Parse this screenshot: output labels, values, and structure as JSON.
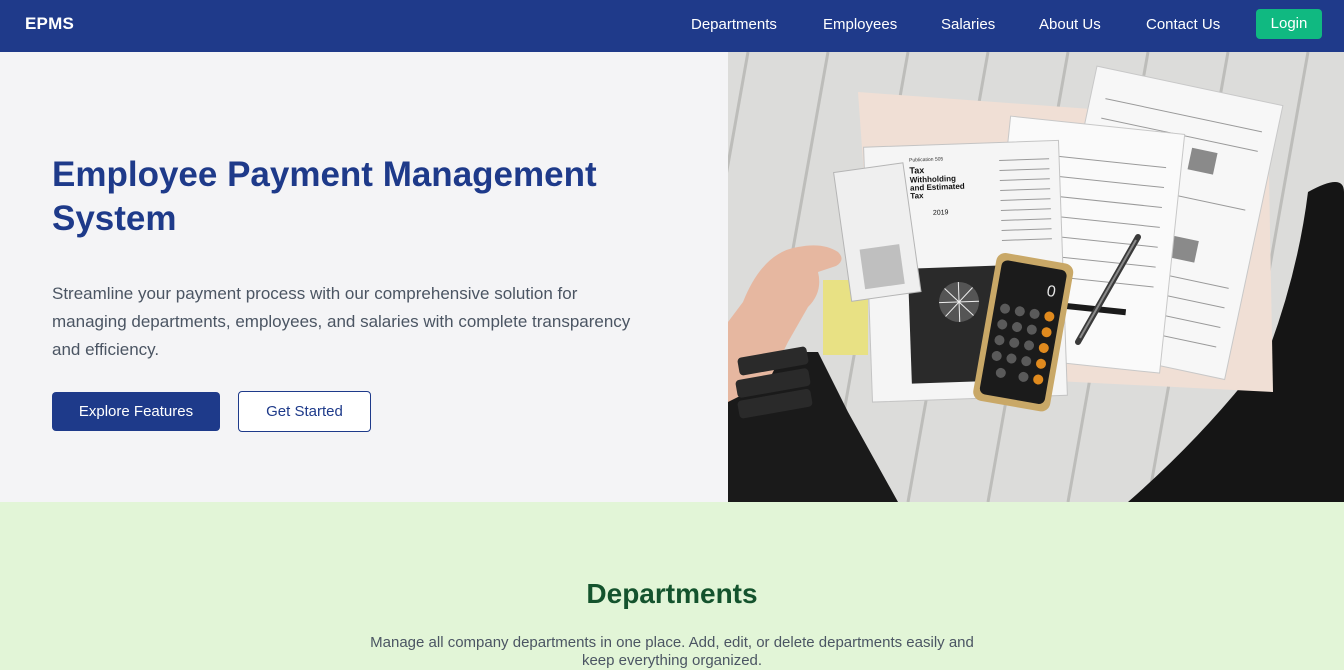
{
  "navbar": {
    "brand": "EPMS",
    "links": [
      {
        "label": "Departments"
      },
      {
        "label": "Employees"
      },
      {
        "label": "Salaries"
      },
      {
        "label": "About Us"
      },
      {
        "label": "Contact Us"
      }
    ],
    "login_label": "Login"
  },
  "hero": {
    "title": "Employee Payment Management System",
    "description": "Streamline your payment process with our comprehensive solution for managing departments, employees, and salaries with complete transparency and efficiency.",
    "primary_button": "Explore Features",
    "secondary_button": "Get Started",
    "image": {
      "form_title": "Tax Withholding and Estimated Tax",
      "form_year": "2019",
      "form_publication": "Publication 505",
      "calculator_display": "0"
    }
  },
  "departments": {
    "title": "Departments",
    "description": "Manage all company departments in one place. Add, edit, or delete departments easily and keep everything organized."
  },
  "colors": {
    "nav_bg": "#1f3a8a",
    "accent_green": "#10b981",
    "hero_title": "#1e3a8a",
    "section_bg": "#e2f5d7",
    "section_title": "#14532d"
  }
}
